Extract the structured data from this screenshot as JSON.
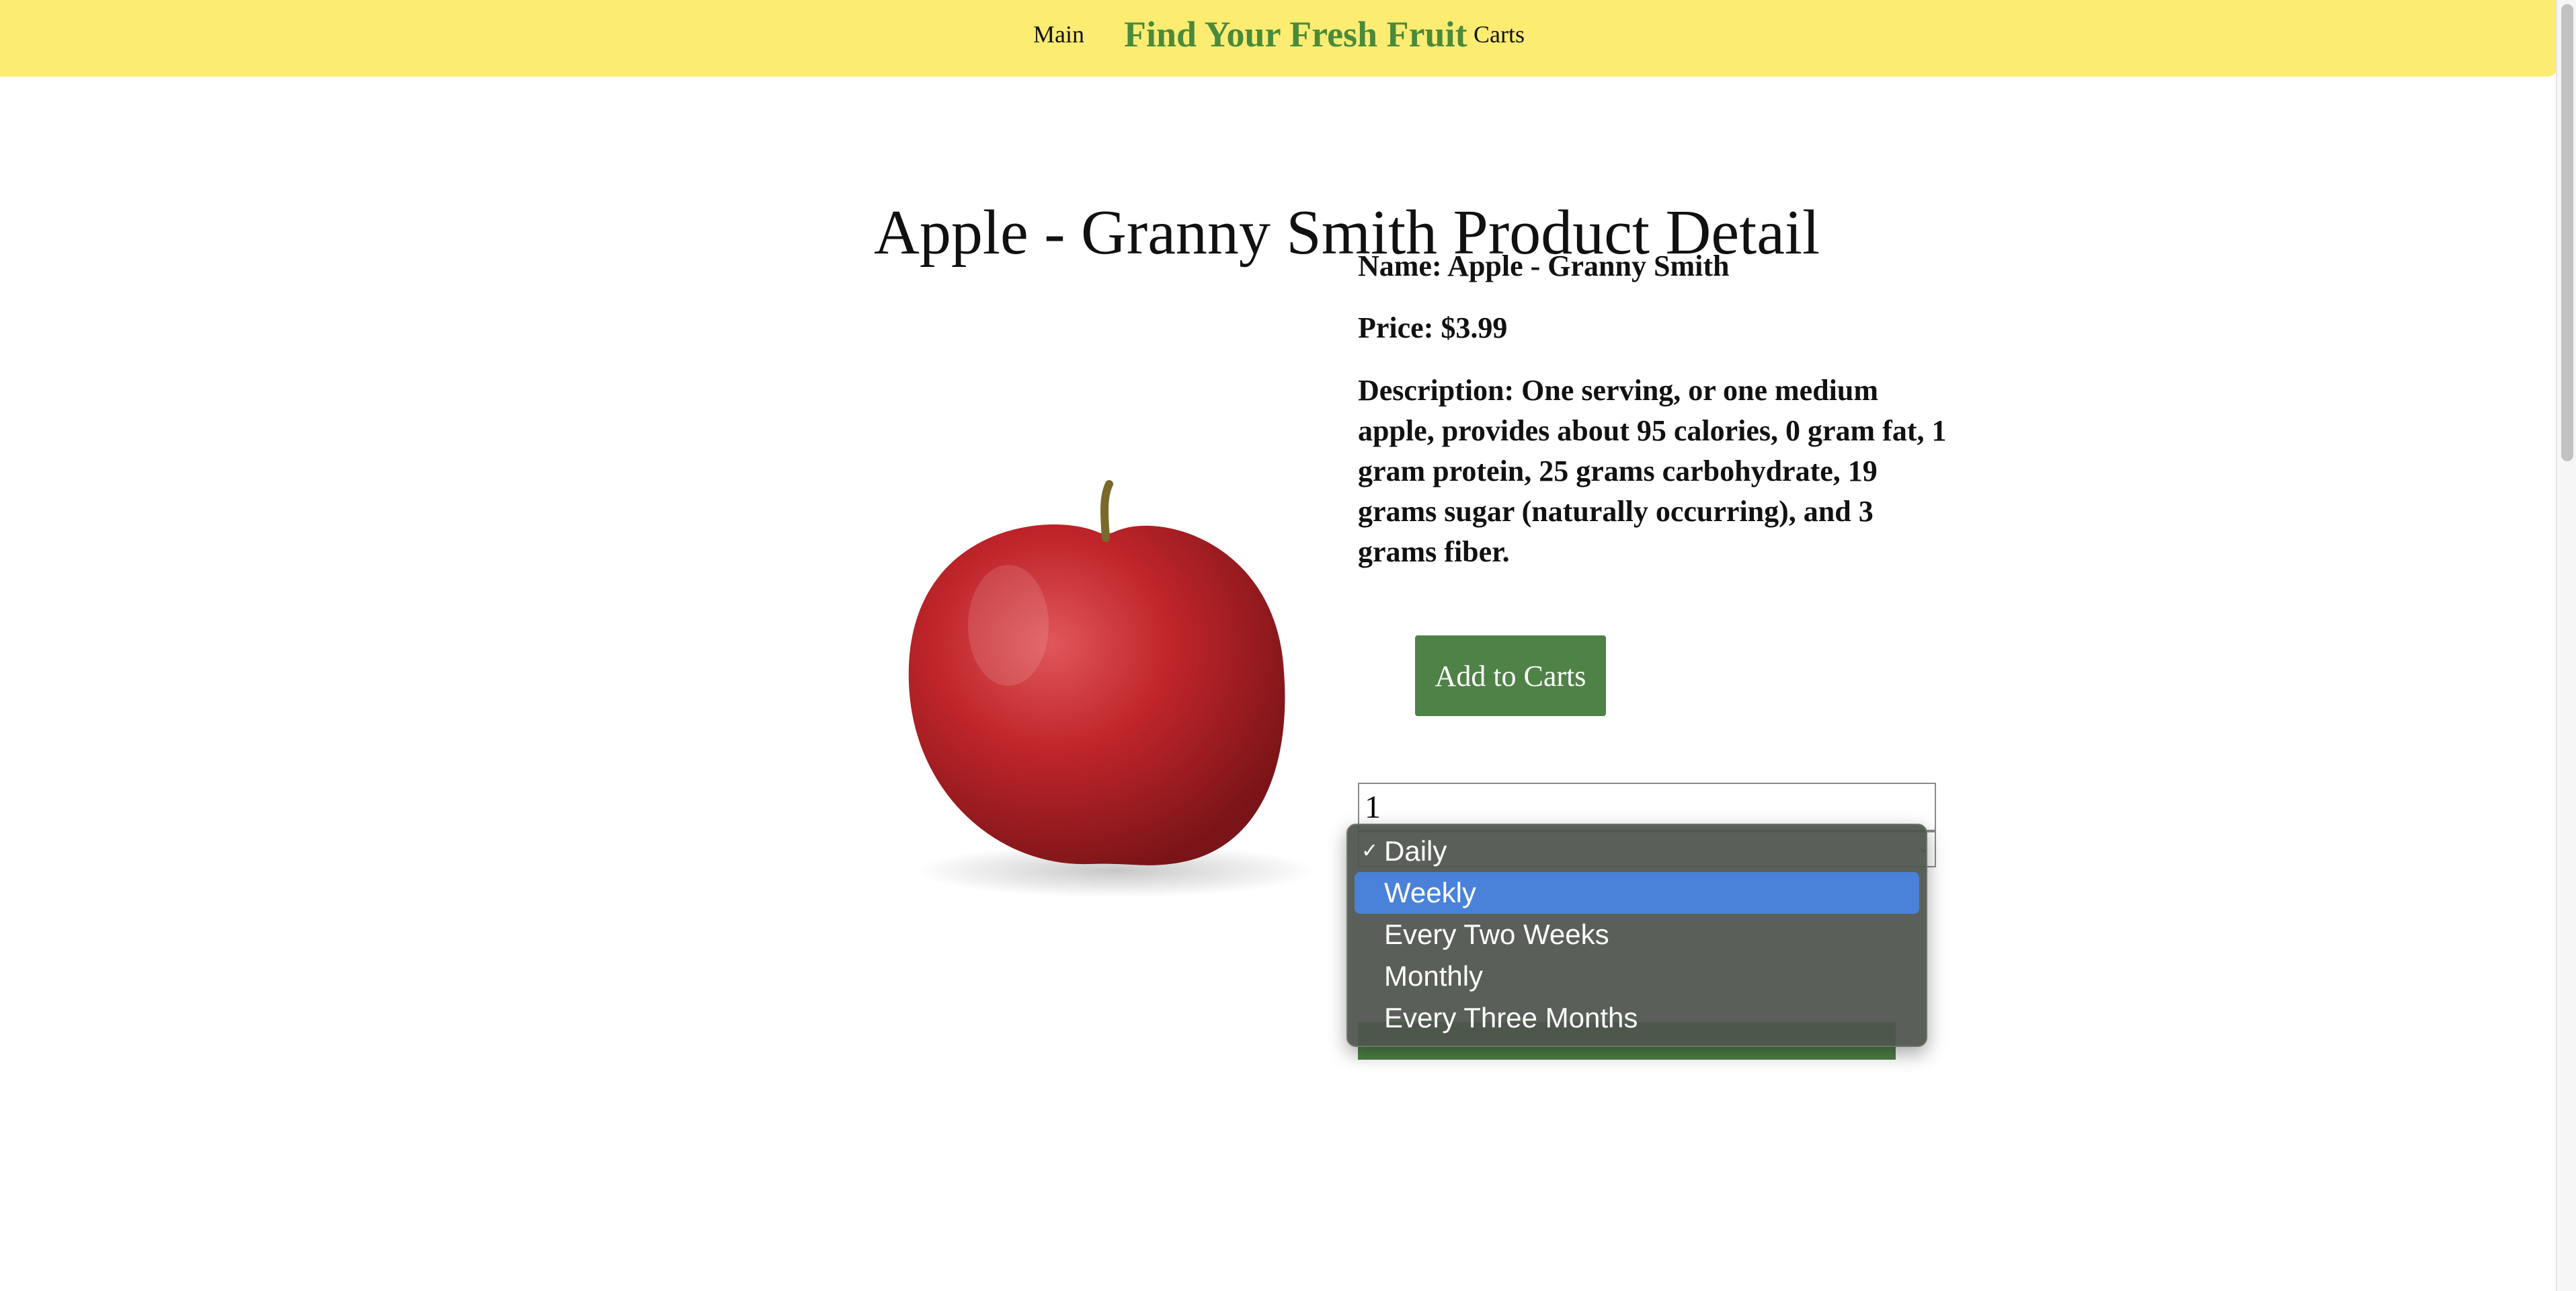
{
  "nav": {
    "main_label": "Main",
    "brand": "Find Your Fresh Fruit",
    "carts_label": "Carts"
  },
  "page": {
    "title": "Apple - Granny Smith Product Detail"
  },
  "product": {
    "name_line": "Name: Apple - Granny Smith",
    "price_line": "Price: $3.99",
    "description_line": "Description: One serving, or one medium apple, provides about 95 calories, 0 gram fat, 1 gram protein, 25 grams carbohydrate, 19 grams sugar (naturally occurring), and 3 grams fiber."
  },
  "actions": {
    "add_to_carts_label": "Add to Carts"
  },
  "form": {
    "quantity_value": "1",
    "frequency_selected": "Daily",
    "frequency_options": [
      "Daily",
      "Weekly",
      "Every Two Weeks",
      "Monthly",
      "Every Three Months"
    ],
    "frequency_highlighted": "Weekly"
  },
  "colors": {
    "navbar_bg": "#fcec72",
    "brand_green": "#4a8a3a",
    "button_green": "#4f8247",
    "highlight_blue": "#4a82da",
    "apple_red": "#c0252a"
  },
  "icons": {
    "checkmark": "checkmark-icon",
    "select_chevron": "chevron-updown-icon"
  }
}
